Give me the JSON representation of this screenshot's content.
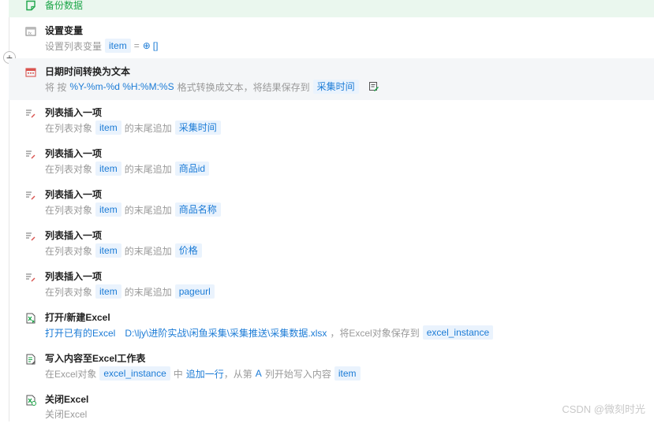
{
  "top_step": {
    "label": "备份数据"
  },
  "plus_button": "+",
  "steps": [
    {
      "title": "设置变量",
      "desc_prefix": "设置列表变量",
      "var": "item",
      "op": "=",
      "value": "[]"
    },
    {
      "title": "日期时间转换为文本",
      "p1": "将 按",
      "format": "%Y-%m-%d %H:%M:%S",
      "p2": "格式转换成文本，将结果保存到",
      "target": "采集时间"
    },
    {
      "title": "列表插入一项",
      "p1": "在列表对象",
      "list": "item",
      "p2": "的末尾追加",
      "value": "采集时间"
    },
    {
      "title": "列表插入一项",
      "p1": "在列表对象",
      "list": "item",
      "p2": "的末尾追加",
      "value": "商品id"
    },
    {
      "title": "列表插入一项",
      "p1": "在列表对象",
      "list": "item",
      "p2": "的末尾追加",
      "value": "商品名称"
    },
    {
      "title": "列表插入一项",
      "p1": "在列表对象",
      "list": "item",
      "p2": "的末尾追加",
      "value": "价格"
    },
    {
      "title": "列表插入一项",
      "p1": "在列表对象",
      "list": "item",
      "p2": "的末尾追加",
      "value": "pageurl"
    },
    {
      "title": "打开/新建Excel",
      "p1": "打开已有的Excel",
      "path": "D:\\ljy\\进阶实战\\闲鱼采集\\采集推送\\采集数据.xlsx",
      "p2": "，将Excel对象保存到",
      "target": "excel_instance"
    },
    {
      "title": "写入内容至Excel工作表",
      "p1": "在Excel对象",
      "obj": "excel_instance",
      "p2": "中",
      "mode": "追加一行",
      "p3": "，从第",
      "col": "A",
      "p4": "列开始写入内容",
      "value": "item"
    },
    {
      "title": "关闭Excel",
      "desc": "关闭Excel"
    }
  ],
  "watermark": "CSDN @微刻时光"
}
